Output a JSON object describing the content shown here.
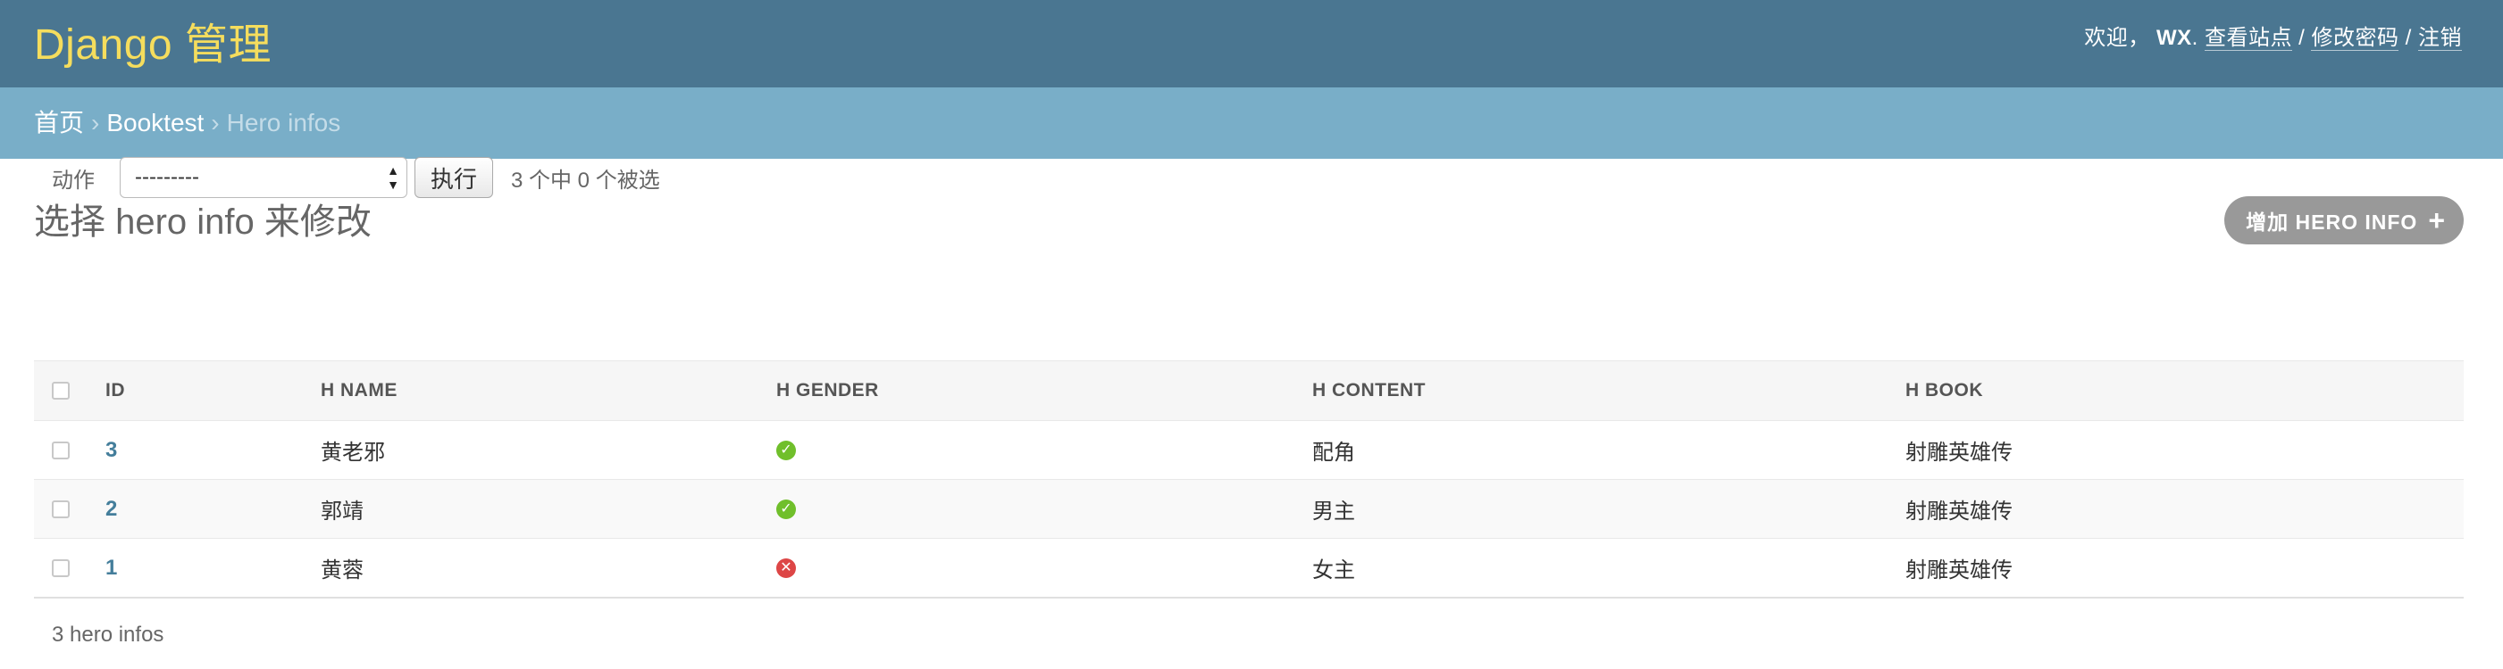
{
  "header": {
    "branding": "Django 管理",
    "welcome": "欢迎，",
    "username": "WX",
    "view_site": "查看站点",
    "change_password": "修改密码",
    "logout": "注销",
    "sep": "/",
    "dot": "."
  },
  "breadcrumbs": {
    "home": "首页",
    "app": "Booktest",
    "current": "Hero infos",
    "sep": "›"
  },
  "page": {
    "title": "选择 hero info 来修改",
    "add_button": "增加 HERO INFO",
    "add_icon": "+"
  },
  "actions": {
    "label": "动作",
    "selected": "---------",
    "go": "执行",
    "counter": "3 个中 0 个被选"
  },
  "table": {
    "headers": [
      "ID",
      "H NAME",
      "H GENDER",
      "H CONTENT",
      "H BOOK"
    ],
    "rows": [
      {
        "id": "3",
        "name": "黄老邪",
        "gender": true,
        "content": "配角",
        "book": "射雕英雄传"
      },
      {
        "id": "2",
        "name": "郭靖",
        "gender": true,
        "content": "男主",
        "book": "射雕英雄传"
      },
      {
        "id": "1",
        "name": "黄蓉",
        "gender": false,
        "content": "女主",
        "book": "射雕英雄传"
      }
    ]
  },
  "paginator": "3 hero infos",
  "colors": {
    "header_bg": "#4a7691",
    "branding": "#f5dd5d",
    "breadcrumbs_bg": "#79aec8",
    "link": "#447e9b",
    "yes": "#70bf2b",
    "no": "#dd4646"
  },
  "icons": {
    "yes": "check-circle-icon",
    "no": "x-circle-icon",
    "add": "plus-icon"
  }
}
